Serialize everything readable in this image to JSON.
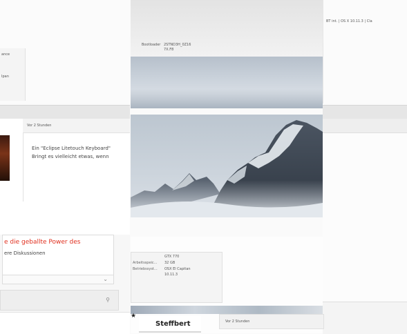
{
  "left": {
    "sidebar_word_1": "ance",
    "sidebar_word_2": "Ipan",
    "post_time": "Vor 2 Stunden",
    "post_line_1": "Ein \"Eclipse Litetouch Keyboard\"",
    "post_line_2": "Bringt es vielleicht etwas, wenn",
    "promo_red": "e die geballte Power des",
    "promo_sub": "ere Diskussionen"
  },
  "center": {
    "bootloader_label": "Bootloader",
    "bootloader_value_1": "2STND3H_0Z16",
    "bootloader_value_2": "7X.F8",
    "gpu": "GTX 770",
    "ram_label": "Arbeitsspeic...",
    "ram_value": "32 GB",
    "os_label": "Betriebssyst...",
    "os_value_1": "OSX El Capitan",
    "os_value_2": "10.11.3",
    "username": "Steffbert",
    "post_time": "Vor 2 Stunden"
  },
  "right": {
    "top_line": "BT int. | OS X 10.11.3 | Cla"
  },
  "icons": {
    "star": "star-icon",
    "chevron": "chevron-down-icon",
    "wrench": "wrench-icon"
  }
}
